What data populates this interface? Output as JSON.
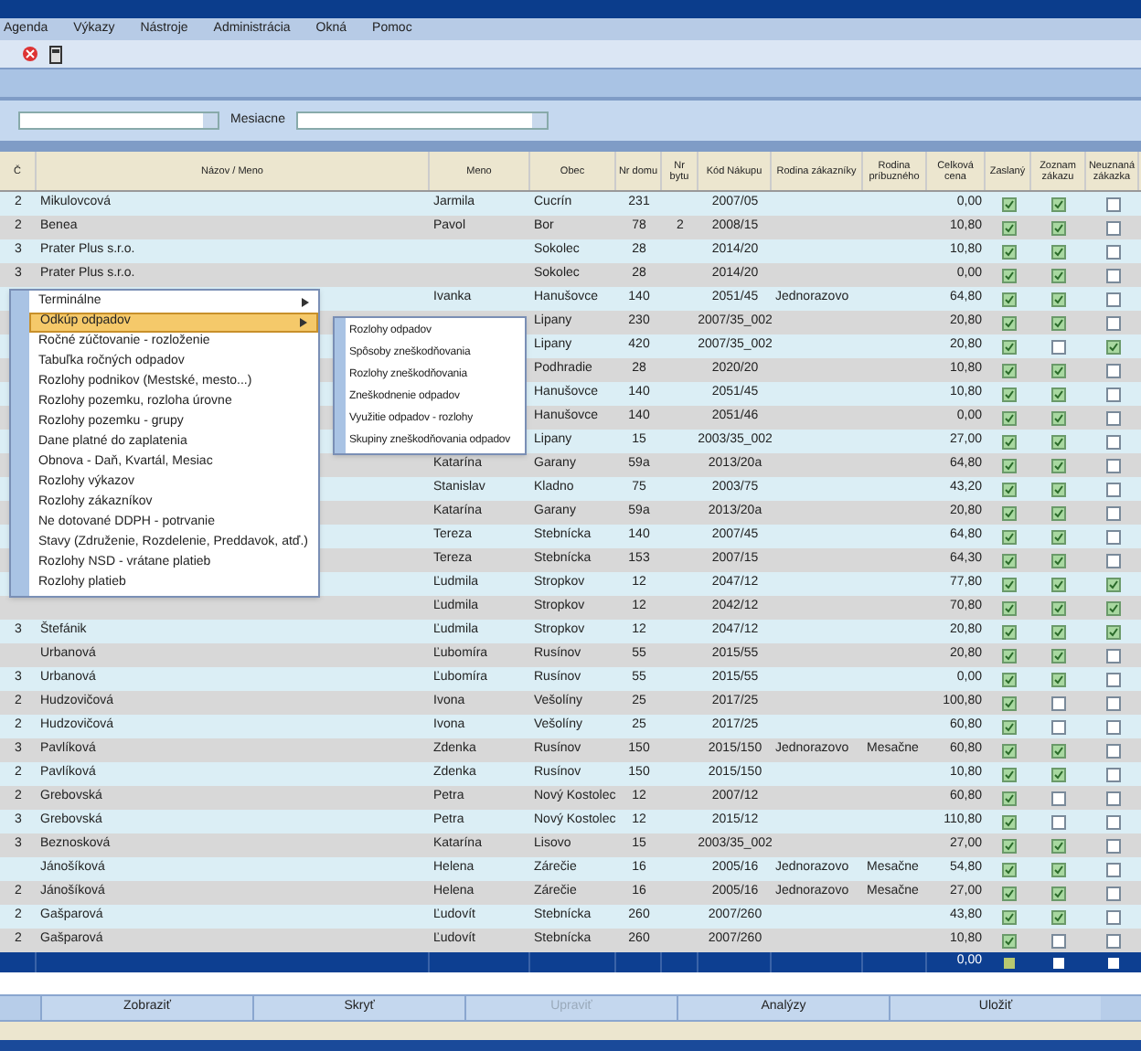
{
  "menu_bar": [
    "Agenda",
    "Výkazy",
    "Nástroje",
    "Administrácia",
    "Okná",
    "Pomoc"
  ],
  "filter": {
    "label": "Mesiacne"
  },
  "table": {
    "columns": [
      "Č",
      "Názov / Meno",
      "Meno",
      "Obec",
      "Nr domu",
      "Nr bytu",
      "Kód Nákupu",
      "Rodina zákazníky",
      "Rodina príbuzného",
      "Celková cena",
      "Zaslaný",
      "Zoznam zákazu",
      "Neuznaná zákazka"
    ],
    "rows": [
      {
        "n": "2",
        "name": "Mikulovcová",
        "meno": "Jarmila",
        "obec": "Cucrín",
        "dom": "231",
        "byt": "",
        "kod": "2007/05",
        "r1": "",
        "r2": "",
        "suma": "0,00",
        "sent": true,
        "listed": true,
        "rejected": false
      },
      {
        "n": "2",
        "name": "Benea",
        "meno": "Pavol",
        "obec": "Bor",
        "dom": "78",
        "byt": "2",
        "kod": "2008/15",
        "r1": "",
        "r2": "",
        "suma": "10,80",
        "sent": true,
        "listed": true,
        "rejected": false
      },
      {
        "n": "3",
        "name": "Prater Plus s.r.o.",
        "meno": "",
        "obec": "Sokolec",
        "dom": "28",
        "byt": "",
        "kod": "2014/20",
        "r1": "",
        "r2": "",
        "suma": "10,80",
        "sent": true,
        "listed": true,
        "rejected": false
      },
      {
        "n": "3",
        "name": "Prater Plus s.r.o.",
        "meno": "",
        "obec": "Sokolec",
        "dom": "28",
        "byt": "",
        "kod": "2014/20",
        "r1": "",
        "r2": "",
        "suma": "0,00",
        "sent": true,
        "listed": true,
        "rejected": false
      },
      {
        "n": "",
        "meno": "Ivanka",
        "obec": "Hanušovce",
        "dom": "140",
        "byt": "",
        "kod": "2051/45",
        "r1": "Jednorazovo",
        "r2": "",
        "suma": "64,80",
        "sent": true,
        "listed": true,
        "rejected": false
      },
      {
        "n": "",
        "obec": "Lipany",
        "dom": "230",
        "byt": "",
        "kod": "2007/35_002",
        "r1": "",
        "r2": "",
        "suma": "20,80",
        "sent": true,
        "listed": true,
        "rejected": false
      },
      {
        "n": "",
        "obec": "Lipany",
        "dom": "420",
        "byt": "",
        "kod": "2007/35_002",
        "r1": "",
        "r2": "",
        "suma": "20,80",
        "sent": true,
        "listed": false,
        "rejected": true
      },
      {
        "n": "",
        "obec": "Podhradie",
        "dom": "28",
        "byt": "",
        "kod": "2020/20",
        "r1": "",
        "r2": "",
        "suma": "10,80",
        "sent": true,
        "listed": true,
        "rejected": false
      },
      {
        "n": "",
        "obec": "Hanušovce",
        "dom": "140",
        "byt": "",
        "kod": "2051/45",
        "r1": "",
        "r2": "",
        "suma": "10,80",
        "sent": true,
        "listed": true,
        "rejected": false
      },
      {
        "n": "",
        "obec": "Hanušovce",
        "dom": "140",
        "byt": "",
        "kod": "2051/46",
        "r1": "",
        "r2": "",
        "suma": "0,00",
        "sent": true,
        "listed": true,
        "rejected": false
      },
      {
        "n": "",
        "obec": "Lipany",
        "dom": "15",
        "byt": "",
        "kod": "2003/35_002",
        "r1": "",
        "r2": "",
        "suma": "27,00",
        "sent": true,
        "listed": true,
        "rejected": false
      },
      {
        "n": "",
        "meno": "Katarína",
        "obec": "Garany",
        "dom": "59a",
        "byt": "",
        "kod": "2013/20a",
        "r1": "",
        "r2": "",
        "suma": "64,80",
        "sent": true,
        "listed": true,
        "rejected": false
      },
      {
        "n": "",
        "meno": "Stanislav",
        "obec": "Kladno",
        "dom": "75",
        "byt": "",
        "kod": "2003/75",
        "r1": "",
        "r2": "",
        "suma": "43,20",
        "sent": true,
        "listed": true,
        "rejected": false
      },
      {
        "n": "",
        "meno": "Katarína",
        "obec": "Garany",
        "dom": "59a",
        "byt": "",
        "kod": "2013/20a",
        "r1": "",
        "r2": "",
        "suma": "20,80",
        "sent": true,
        "listed": true,
        "rejected": false
      },
      {
        "n": "",
        "meno": "Tereza",
        "obec": "Stebnícka",
        "dom": "140",
        "byt": "",
        "kod": "2007/45",
        "r1": "",
        "r2": "",
        "suma": "64,80",
        "sent": true,
        "listed": true,
        "rejected": false
      },
      {
        "n": "",
        "meno": "Tereza",
        "obec": "Stebnícka",
        "dom": "153",
        "byt": "",
        "kod": "2007/15",
        "r1": "",
        "r2": "",
        "suma": "64,30",
        "sent": true,
        "listed": true,
        "rejected": false
      },
      {
        "n": "",
        "meno": "Ľudmila",
        "obec": "Stropkov",
        "dom": "12",
        "byt": "",
        "kod": "2047/12",
        "r1": "",
        "r2": "",
        "suma": "77,80",
        "sent": true,
        "listed": true,
        "rejected": true
      },
      {
        "n": "",
        "meno": "Ľudmila",
        "obec": "Stropkov",
        "dom": "12",
        "byt": "",
        "kod": "2042/12",
        "r1": "",
        "r2": "",
        "suma": "70,80",
        "sent": true,
        "listed": true,
        "rejected": true
      },
      {
        "n": "3",
        "name": "Štefánik",
        "meno": "Ľudmila",
        "obec": "Stropkov",
        "dom": "12",
        "byt": "",
        "kod": "2047/12",
        "r1": "",
        "r2": "",
        "suma": "20,80",
        "sent": true,
        "listed": true,
        "rejected": true
      },
      {
        "n": "",
        "name": "Urbanová",
        "meno": "Ľubomíra",
        "obec": "Rusínov",
        "dom": "55",
        "byt": "",
        "kod": "2015/55",
        "r1": "",
        "r2": "",
        "suma": "20,80",
        "sent": true,
        "listed": true,
        "rejected": false
      },
      {
        "n": "3",
        "name": "Urbanová",
        "meno": "Ľubomíra",
        "obec": "Rusínov",
        "dom": "55",
        "byt": "",
        "kod": "2015/55",
        "r1": "",
        "r2": "",
        "suma": "0,00",
        "sent": true,
        "listed": true,
        "rejected": false
      },
      {
        "n": "2",
        "name": "Hudzovičová",
        "meno": "Ivona",
        "obec": "Vešolíny",
        "dom": "25",
        "byt": "",
        "kod": "2017/25",
        "r1": "",
        "r2": "",
        "suma": "100,80",
        "sent": true,
        "listed": false,
        "rejected": false
      },
      {
        "n": "2",
        "name": "Hudzovičová",
        "meno": "Ivona",
        "obec": "Vešolíny",
        "dom": "25",
        "byt": "",
        "kod": "2017/25",
        "r1": "",
        "r2": "",
        "suma": "60,80",
        "sent": true,
        "listed": false,
        "rejected": false
      },
      {
        "n": "3",
        "name": "Pavlíková",
        "meno": "Zdenka",
        "obec": "Rusínov",
        "dom": "150",
        "byt": "",
        "kod": "2015/150",
        "r1": "Jednorazovo",
        "r2": "Mesačne",
        "suma": "60,80",
        "sent": true,
        "listed": true,
        "rejected": false
      },
      {
        "n": "2",
        "name": "Pavlíková",
        "meno": "Zdenka",
        "obec": "Rusínov",
        "dom": "150",
        "byt": "",
        "kod": "2015/150",
        "r1": "",
        "r2": "",
        "suma": "10,80",
        "sent": true,
        "listed": true,
        "rejected": false
      },
      {
        "n": "2",
        "name": "Grebovská",
        "meno": "Petra",
        "obec": "Nový Kostolec",
        "dom": "12",
        "byt": "",
        "kod": "2007/12",
        "r1": "",
        "r2": "",
        "suma": "60,80",
        "sent": true,
        "listed": false,
        "rejected": false
      },
      {
        "n": "3",
        "name": "Grebovská",
        "meno": "Petra",
        "obec": "Nový Kostolec",
        "dom": "12",
        "byt": "",
        "kod": "2015/12",
        "r1": "",
        "r2": "",
        "suma": "110,80",
        "sent": true,
        "listed": false,
        "rejected": false
      },
      {
        "n": "3",
        "name": "Beznosková",
        "meno": "Katarína",
        "obec": "Lisovo",
        "dom": "15",
        "byt": "",
        "kod": "2003/35_002",
        "r1": "",
        "r2": "",
        "suma": "27,00",
        "sent": true,
        "listed": true,
        "rejected": false
      },
      {
        "n": "",
        "name": "Jánošíková",
        "meno": "Helena",
        "obec": "Zárečie",
        "dom": "16",
        "byt": "",
        "kod": "2005/16",
        "r1": "Jednorazovo",
        "r2": "Mesačne",
        "suma": "54,80",
        "sent": true,
        "listed": true,
        "rejected": false
      },
      {
        "n": "2",
        "name": "Jánošíková",
        "meno": "Helena",
        "obec": "Zárečie",
        "dom": "16",
        "byt": "",
        "kod": "2005/16",
        "r1": "Jednorazovo",
        "r2": "Mesačne",
        "suma": "27,00",
        "sent": true,
        "listed": true,
        "rejected": false
      },
      {
        "n": "2",
        "name": "Gašparová",
        "meno": "Ľudovít",
        "obec": "Stebnícka",
        "dom": "260",
        "byt": "",
        "kod": "2007/260",
        "r1": "",
        "r2": "",
        "suma": "43,80",
        "sent": true,
        "listed": true,
        "rejected": false
      },
      {
        "n": "2",
        "name": "Gašparová",
        "meno": "Ľudovít",
        "obec": "Stebnícka",
        "dom": "260",
        "byt": "",
        "kod": "2007/260",
        "r1": "",
        "r2": "",
        "suma": "10,80",
        "sent": true,
        "listed": false,
        "rejected": false
      }
    ],
    "total": "0,00"
  },
  "context_menu": {
    "items": [
      {
        "label": "Terminálne",
        "submenu": true,
        "selected": false
      },
      {
        "label": "Odkúp odpadov",
        "submenu": true,
        "selected": true
      },
      {
        "label": "Ročné zúčtovanie - rozloženie",
        "submenu": false,
        "selected": false
      },
      {
        "label": "Tabuľka ročných odpadov",
        "submenu": false,
        "selected": false
      },
      {
        "label": "Rozlohy podnikov (Mestské, mesto...)",
        "submenu": false,
        "selected": false
      },
      {
        "label": "Rozlohy pozemku, rozloha úrovne",
        "submenu": false,
        "selected": false
      },
      {
        "label": "Rozlohy pozemku - grupy",
        "submenu": false,
        "selected": false
      },
      {
        "label": "Dane platné do zaplatenia",
        "submenu": false,
        "selected": false
      },
      {
        "label": "Obnova - Daň, Kvartál, Mesiac",
        "submenu": false,
        "selected": false
      },
      {
        "label": "Rozlohy výkazov",
        "submenu": false,
        "selected": false
      },
      {
        "label": "Rozlohy zákazníkov",
        "submenu": false,
        "selected": false
      },
      {
        "label": "Ne dotované DDPH - potrvanie",
        "submenu": false,
        "selected": false
      },
      {
        "label": "Stavy (Združenie, Rozdelenie, Preddavok, atď.)",
        "submenu": false,
        "selected": false
      },
      {
        "label": "Rozlohy NSD - vrátane platieb",
        "submenu": false,
        "selected": false
      },
      {
        "label": "Rozlohy platieb",
        "submenu": false,
        "selected": false
      }
    ],
    "submenu": [
      "Rozlohy odpadov",
      "Spôsoby zneškodňovania",
      "Rozlohy zneškodňovania",
      "Zneškodnenie odpadov",
      "Využitie odpadov - rozlohy",
      "Skupiny zneškodňovania odpadov"
    ]
  },
  "buttons": [
    {
      "label": "Zobraziť",
      "disabled": false
    },
    {
      "label": "Skryť",
      "disabled": false
    },
    {
      "label": "Upraviť",
      "disabled": true
    },
    {
      "label": "Analýzy",
      "disabled": false
    },
    {
      "label": "Uložiť",
      "disabled": false
    }
  ]
}
